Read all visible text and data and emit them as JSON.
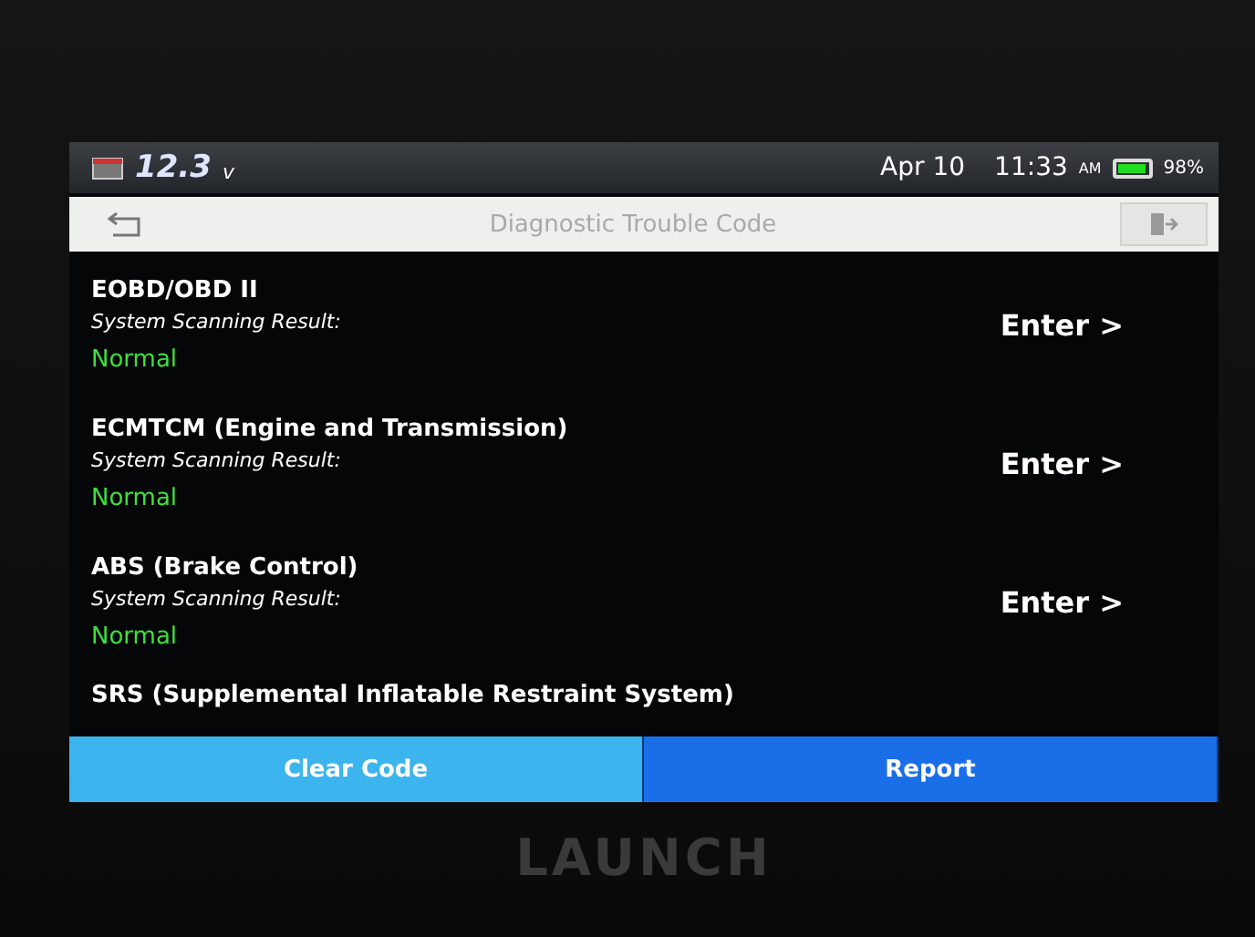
{
  "status_bar": {
    "voltage": "12.3",
    "voltage_unit": "v",
    "date": "Apr 10",
    "time": "11:33",
    "ampm": "AM",
    "battery": "98%"
  },
  "title_bar": {
    "title": "Diagnostic Trouble Code"
  },
  "systems": [
    {
      "name": "EOBD/OBD II",
      "result_label": "System Scanning Result:",
      "result": "Normal",
      "action": "Enter >"
    },
    {
      "name": "ECMTCM (Engine and Transmission)",
      "result_label": "System Scanning Result:",
      "result": "Normal",
      "action": "Enter >"
    },
    {
      "name": "ABS (Brake Control)",
      "result_label": "System Scanning Result:",
      "result": "Normal",
      "action": "Enter >"
    },
    {
      "name": "SRS (Supplemental Inflatable Restraint System)"
    }
  ],
  "buttons": [
    {
      "label": "Clear Code",
      "selected": true
    },
    {
      "label": "Report",
      "selected": false
    }
  ],
  "device": {
    "brand": "LAUNCH"
  }
}
